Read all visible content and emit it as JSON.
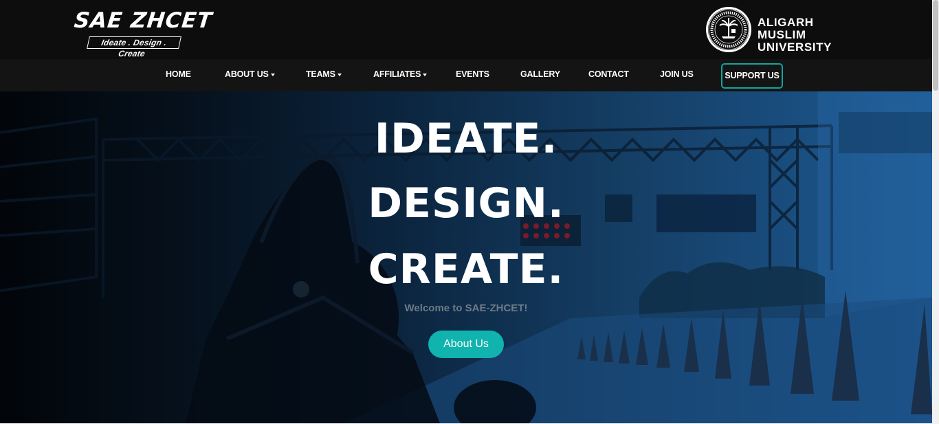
{
  "header": {
    "logo_text": "SAE ZHCET",
    "logo_tagline": "Ideate . Design . Create",
    "university_line1": "ALIGARH MUSLIM",
    "university_line2": "UNIVERSITY"
  },
  "nav": {
    "items": [
      {
        "label": "HOME",
        "dropdown": false
      },
      {
        "label": "ABOUT US",
        "dropdown": true
      },
      {
        "label": "TEAMS",
        "dropdown": true
      },
      {
        "label": "AFFILIATES",
        "dropdown": true
      },
      {
        "label": "EVENTS",
        "dropdown": false
      },
      {
        "label": "GALLERY",
        "dropdown": false
      },
      {
        "label": "CONTACT",
        "dropdown": false
      },
      {
        "label": "JOIN US",
        "dropdown": false
      }
    ],
    "support_label": "SUPPORT US",
    "support_border_color": "#12a5a0"
  },
  "hero": {
    "line1": "IDEATE.",
    "line2": "DESIGN.",
    "line3": "CREATE.",
    "welcome": "Welcome to SAE-ZHCET!",
    "button_label": "About Us",
    "button_color": "#10b3ad"
  }
}
